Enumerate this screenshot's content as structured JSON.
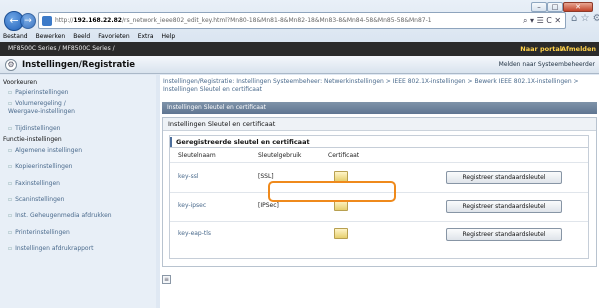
{
  "browser": {
    "url_prefix": "http://",
    "url_host": "192.168.22.82",
    "url_rest": "/rs_network_ieee802_edit_key.html?Mn80-18&Mn81-8&Mn82-18&Mn83-8&Mn84-58&Mn85-58&Mn87-1",
    "addr_tools": "⌕ ▾ ☰ C ✕",
    "tab_icons": "⌂ ☆ ⚙",
    "menu": [
      "Bestand",
      "Bewerken",
      "Beeld",
      "Favorieten",
      "Extra",
      "Help"
    ],
    "window_controls": {
      "min": "–",
      "max": "□",
      "close": "✕"
    }
  },
  "header": {
    "printer_model": "MF8500C Series / MF8500C Series /",
    "portal": "Naar portal",
    "logout": "Afmelden",
    "page_title": "Instellingen/Registratie",
    "to_admin": "Melden naar Systeembeheerder"
  },
  "sidebar": {
    "sections": [
      {
        "title": "Voorkeuren",
        "items": [
          "Papierinstellingen",
          "Volumeregeling / Weergave-instellingen",
          "Tijdinstellingen"
        ]
      },
      {
        "title": "Functie-instellingen",
        "items": [
          "Algemene instellingen",
          "Kopieerinstellingen",
          "Faxinstellingen",
          "Scaninstellingen",
          "Inst. Geheugenmedia afdrukken",
          "Printerinstellingen",
          "Instellingen afdrukrapport"
        ]
      }
    ]
  },
  "main": {
    "breadcrumb": "Instellingen/Registratie: Instellingen Systeembeheer: Netwerkinstellingen > IEEE 802.1X-instellingen > Bewerk IEEE 802.1X-instellingen > Instellingen Sleutel en certificaat",
    "section_title": "Instellingen Sleutel en certificaat",
    "panel_title": "Instellingen Sleutel en certificaat",
    "registered_title": "Geregistreerde sleutel en certificaat",
    "columns": [
      "Sleutelnaam",
      "Sleutelgebruik",
      "Certificaat"
    ],
    "rows": [
      {
        "name": "key-ssl",
        "usage": "[SSL]",
        "button": "Registreer standaardsleutel"
      },
      {
        "name": "key-ipsec",
        "usage": "[IPSec]",
        "button": "Registreer standaardsleutel"
      },
      {
        "name": "key-eap-tls",
        "usage": "",
        "button": "Registreer standaardsleutel"
      }
    ]
  },
  "accent": {
    "highlight": "#ef8a1c",
    "printer_bar": "#2a2a2a",
    "link": "#4a6a8c"
  }
}
